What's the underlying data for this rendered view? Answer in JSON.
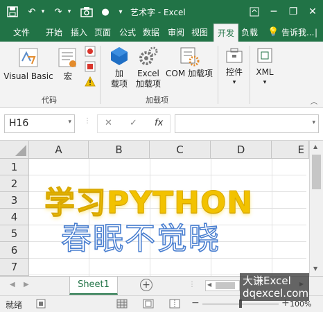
{
  "titlebar": {
    "title": "艺术字 - Excel",
    "accent_color": "#217346"
  },
  "tabs": [
    {
      "label": "文件"
    },
    {
      "label": "开始"
    },
    {
      "label": "插入"
    },
    {
      "label": "页面"
    },
    {
      "label": "公式"
    },
    {
      "label": "数据"
    },
    {
      "label": "审阅"
    },
    {
      "label": "视图"
    },
    {
      "label": "开发"
    },
    {
      "label": "负载"
    },
    {
      "label": "告诉我..."
    }
  ],
  "ribbon": {
    "visual_basic": "Visual Basic",
    "macro": "宏",
    "group_code": "代码",
    "addins_line1": "加",
    "addins_line2": "载项",
    "excel_addins_line1": "Excel",
    "excel_addins_line2": "加载项",
    "com_addins": "COM 加载项",
    "group_addins": "加载项",
    "controls": "控件",
    "xml": "XML"
  },
  "formula_bar": {
    "name_box": "H16",
    "cancel_icon": "✕",
    "enter_icon": "✓",
    "fx_label": "fx"
  },
  "grid": {
    "columns": [
      "A",
      "B",
      "C",
      "D",
      "E"
    ],
    "rows": [
      "1",
      "2",
      "3",
      "4",
      "5",
      "6",
      "7"
    ]
  },
  "wordart": {
    "line1": "学习PYTHON",
    "line2": "春眠不觉晓",
    "line1_color": "#f2c200",
    "line2_color": "#4a7fd0"
  },
  "sheets": [
    {
      "label": "Sheet1"
    }
  ],
  "status": {
    "mode": "就绪",
    "zoom": "100%"
  },
  "watermark": {
    "line1": "大谦Excel",
    "line2": "dqexcel.com"
  }
}
